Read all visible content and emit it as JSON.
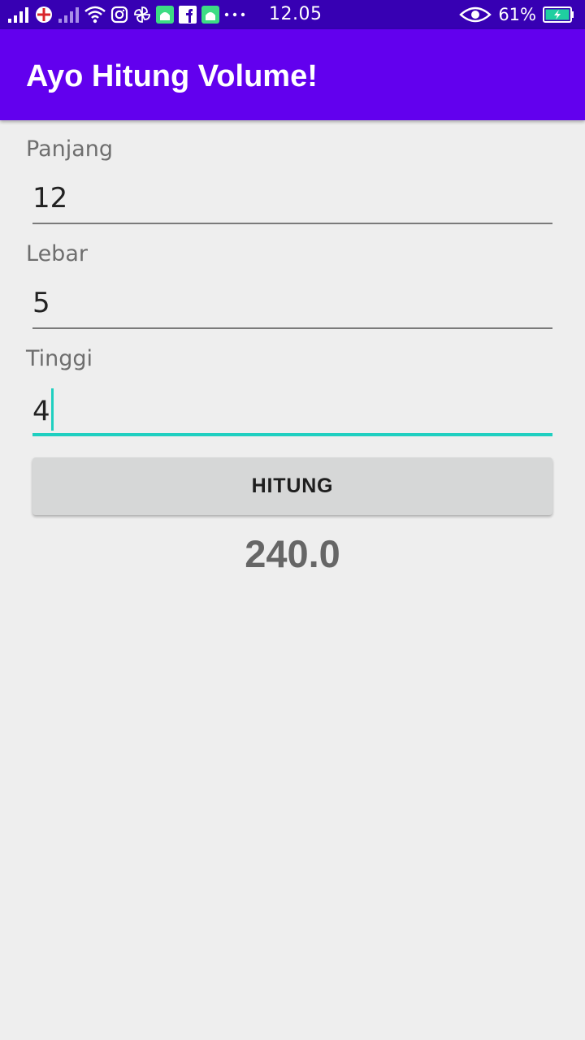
{
  "status_bar": {
    "time": "12.05",
    "battery_percent": "61%",
    "icons": [
      "signal-icon",
      "pocket-app-icon",
      "signal-2-icon",
      "wifi-icon",
      "instagram-icon",
      "pinwheel-icon",
      "android-icon",
      "facebook-icon",
      "android-icon",
      "more-icon"
    ],
    "right_icons": [
      "eye-icon",
      "battery-charging-icon"
    ],
    "colors": {
      "background": "#3700b3",
      "battery_fill": "#1fcfa0"
    }
  },
  "app_bar": {
    "title": "Ayo Hitung Volume!",
    "background": "#6200ee"
  },
  "form": {
    "fields": [
      {
        "label": "Panjang",
        "value": "12"
      },
      {
        "label": "Lebar",
        "value": "5"
      },
      {
        "label": "Tinggi",
        "value": "4"
      }
    ],
    "focused_field": "Tinggi",
    "accent_color": "#1fcfc0"
  },
  "button": {
    "label": "HITUNG"
  },
  "result": {
    "value": "240.0"
  }
}
